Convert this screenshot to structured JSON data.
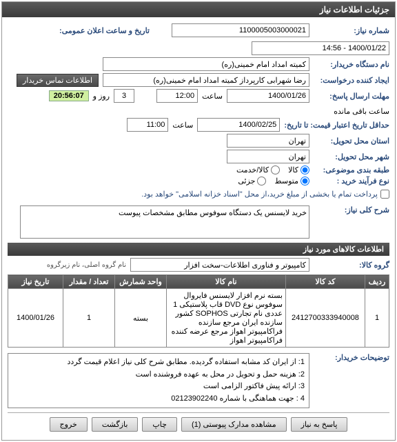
{
  "panelTitle": "جزئیات اطلاعات نیاز",
  "fields": {
    "niazNoLabel": "شماره نیاز:",
    "niazNo": "1100005003000021",
    "announceLabel": "تاریخ و ساعت اعلان عمومی:",
    "announceVal": "1400/01/22 - 14:56",
    "buyerOrgLabel": "نام دستگاه خریدار:",
    "buyerOrg": "کمیته امداد امام خمینی(ره)",
    "creatorLabel": "ایجاد کننده درخواست:",
    "creator": "رضا شهرابی کارپرداز کمیته امداد امام خمینی(ره)",
    "contactBtn": "اطلاعات تماس خریدار",
    "sendDeadlineLabel": "مهلت ارسال پاسخ:",
    "toDateLabel": "تا تاریخ:",
    "sendDate": "1400/01/26",
    "timeLabel": "ساعت",
    "sendTime": "12:00",
    "daysLeft": "3",
    "daysAndLabel": "روز و",
    "countdown": "20:56:07",
    "remainLabel": "ساعت باقی مانده",
    "validLabel": "حداقل تاریخ اعتبار قیمت: تا تاریخ:",
    "validDate": "1400/02/25",
    "validTime": "11:00",
    "provinceLabel": "استان محل تحویل:",
    "province": "تهران",
    "cityLabel": "شهر محل تحویل:",
    "city": "تهران",
    "groupingLabel": "طبقه بندی موضوعی:",
    "goodsOpt": "کالا",
    "serviceOpt": "کالا/خدمت",
    "buyTypeLabel": "نوع فرآیند خرید :",
    "mediumOpt": "متوسط",
    "smallOpt": "جزئی",
    "partialPayLabel": "پرداخت تمام یا بخشی از مبلغ خرید،از محل \"اسناد خزانه اسلامی\" خواهد بود.",
    "summaryLabel": "شرح کلی نیاز:",
    "summary": "خرید لایسنس یک دستگاه سوفوس مطابق مشخصات پیوست",
    "itemsTitle": "اطلاعات کالاهای مورد نیاز",
    "kalaGroupLabel": "گروه کالا:",
    "kalaGroup": "کامپیوتر و فناوری اطلاعات-سخت افزار",
    "mainGroupSub": "نام گروه اصلی، نام زیرگروه",
    "cols": {
      "row": "ردیف",
      "code": "کد کالا",
      "name": "نام کالا",
      "unit": "واحد شمارش",
      "qty": "تعداد / مقدار",
      "date": "تاریخ نیاز"
    },
    "item": {
      "row": "1",
      "code": "2412700333940008",
      "name": "بسته نرم افزار لایسنس فایروال سوفوس نوع DVD قاب پلاستیکی 1 عددی نام تجارتی SOPHOS کشور سازنده ایران مرجع سازنده فراکامپیوتر اهواز مرجع عرضه کننده فراکامپیوتر اهواز",
      "unit": "بسته",
      "qty": "1",
      "date": "1400/01/26"
    },
    "buyerNotesLabel": "توضیحات خریدار:",
    "buyerNotes1": "1: از ایران کد مشابه استفاده گردیده. مطابق شرح کلی نیاز اعلام قیمت گردد",
    "buyerNotes2": "2: هزینه حمل و تحویل در محل به عهده فروشنده است",
    "buyerNotes3": "3: ارائه پیش فاکتور الزامی است",
    "buyerNotes4": "4 : جهت هماهنگی با شماره 02123902240",
    "btnReply": "پاسخ به نیاز",
    "btnAttach": "مشاهده مدارک پیوستی (1)",
    "btnPrint": "چاپ",
    "btnBack": "بازگشت",
    "btnExit": "خروج"
  }
}
